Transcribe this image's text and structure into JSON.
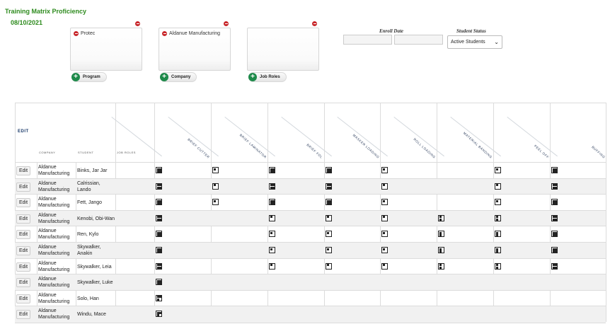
{
  "page": {
    "title": "Training Matrix Proficiency",
    "date": "08/10/2021"
  },
  "filters": {
    "program": {
      "button": "Program",
      "items": [
        "Protec"
      ]
    },
    "company": {
      "button": "Company",
      "items": [
        "Aldanue Manufacturing"
      ]
    },
    "job_roles": {
      "button": "Job Roles",
      "items": []
    }
  },
  "enroll_date": {
    "label": "Enroll Date",
    "from": "",
    "to": ""
  },
  "student_status": {
    "label": "Student Status",
    "selected": "Active Students"
  },
  "matrix": {
    "edit_header": "EDIT",
    "col_company": "COMPANY",
    "col_student": "STUDENT",
    "col_job_roles": "JOB ROLES",
    "roles": [
      "BRIEF CUTTER",
      "BRIEF LAMINATOR",
      "BRIEF FOL",
      "MASKER LOADING",
      "ROLL LOADING",
      "MATERIAL BANDING",
      "PEEL OFF",
      "BUFFING"
    ],
    "edit_label": "Edit",
    "rows": [
      {
        "company": "Aldanue Manufacturing",
        "student": "Binks, Jar Jar",
        "cells": [
          "full",
          "one",
          "full",
          "full",
          "one",
          "",
          "one",
          "full"
        ]
      },
      {
        "company": "Aldanue Manufacturing",
        "student": "Calrissian, Lando",
        "cells": [
          "full",
          "one",
          "full",
          "full",
          "one",
          "",
          "one",
          "full"
        ]
      },
      {
        "company": "Aldanue Manufacturing",
        "student": "Fett, Jango",
        "cells": [
          "full",
          "one",
          "full",
          "full",
          "one",
          "",
          "one",
          "full"
        ]
      },
      {
        "company": "Aldanue Manufacturing",
        "student": "Kenobi, Obi-Wan",
        "cells": [
          "full",
          "",
          "one",
          "one",
          "one",
          "two",
          "two",
          "full"
        ]
      },
      {
        "company": "Aldanue Manufacturing",
        "student": "Ren, Kylo",
        "cells": [
          "full",
          "",
          "one",
          "one",
          "one",
          "two",
          "two",
          "full"
        ]
      },
      {
        "company": "Aldanue Manufacturing",
        "student": "Skywalker, Anakin",
        "cells": [
          "full",
          "",
          "one",
          "one",
          "one",
          "two",
          "two",
          "full"
        ]
      },
      {
        "company": "Aldanue Manufacturing",
        "student": "Skywalker, Leia",
        "cells": [
          "full",
          "",
          "one",
          "one",
          "one",
          "two",
          "two",
          "full"
        ]
      },
      {
        "company": "Aldanue Manufacturing",
        "student": "Skywalker, Luke",
        "cells": [
          "full",
          "",
          "",
          "",
          "",
          "",
          "",
          ""
        ]
      },
      {
        "company": "Aldanue Manufacturing",
        "student": "Solo, Han",
        "cells": [
          "three",
          "",
          "",
          "",
          "",
          "",
          "",
          ""
        ]
      },
      {
        "company": "Aldanue Manufacturing",
        "student": "Windu, Mace",
        "cells": [
          "three",
          "",
          "",
          "",
          "",
          "",
          "",
          ""
        ]
      }
    ]
  }
}
